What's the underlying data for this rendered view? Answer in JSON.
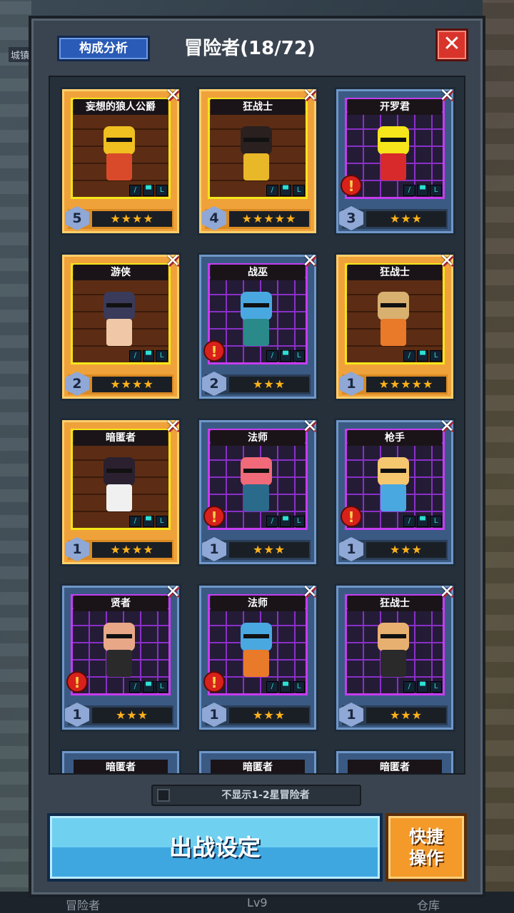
{
  "header": {
    "analysis_label": "构成分析",
    "title": "冒险者(18/72)",
    "close_icon": "close-icon"
  },
  "background": {
    "top_left_text": "城镇",
    "bottom_left_text": "冒险者",
    "bottom_center_text": "Lv9",
    "bottom_right_text": "仓库"
  },
  "cards": [
    {
      "name": "妄想的狼人公爵",
      "level": "5",
      "stars": "★★★★",
      "tier": "gold",
      "alert": false,
      "head": "#f0c020",
      "body": "#d84a2a"
    },
    {
      "name": "狂战士",
      "level": "4",
      "stars": "★★★★★",
      "tier": "gold",
      "alert": false,
      "head": "#2a2020",
      "body": "#e8b828"
    },
    {
      "name": "开罗君",
      "level": "3",
      "stars": "★★★",
      "tier": "blue",
      "alert": true,
      "head": "#f5e51a",
      "body": "#d82a2a"
    },
    {
      "name": "游侠",
      "level": "2",
      "stars": "★★★★",
      "tier": "gold",
      "alert": false,
      "head": "#3a3a5a",
      "body": "#f0c8a8"
    },
    {
      "name": "战巫",
      "level": "2",
      "stars": "★★★",
      "tier": "blue",
      "alert": true,
      "head": "#4aa8e0",
      "body": "#2a8a8a"
    },
    {
      "name": "狂战士",
      "level": "1",
      "stars": "★★★★★",
      "tier": "gold",
      "alert": false,
      "head": "#d8b070",
      "body": "#e87a2a"
    },
    {
      "name": "暗匿者",
      "level": "1",
      "stars": "★★★★",
      "tier": "gold",
      "alert": false,
      "head": "#2a2030",
      "body": "#f0f0f0"
    },
    {
      "name": "法师",
      "level": "1",
      "stars": "★★★",
      "tier": "blue",
      "alert": true,
      "head": "#f06a7a",
      "body": "#2a6a8a"
    },
    {
      "name": "枪手",
      "level": "1",
      "stars": "★★★",
      "tier": "blue",
      "alert": true,
      "head": "#f5c870",
      "body": "#4aa8e0"
    },
    {
      "name": "贤者",
      "level": "1",
      "stars": "★★★",
      "tier": "blue",
      "alert": true,
      "head": "#e8a888",
      "body": "#2a2a2a"
    },
    {
      "name": "法师",
      "level": "1",
      "stars": "★★★",
      "tier": "blue",
      "alert": true,
      "head": "#4aa8e0",
      "body": "#e87a2a"
    },
    {
      "name": "狂战士",
      "level": "1",
      "stars": "★★★",
      "tier": "blue",
      "alert": false,
      "head": "#e8b070",
      "body": "#2a2a2a"
    }
  ],
  "partial_cards": [
    {
      "name": "暗匿者"
    },
    {
      "name": "暗匿者"
    },
    {
      "name": "暗匿者"
    }
  ],
  "toggle": {
    "label": "不显示1-2星冒险者",
    "checked": false
  },
  "buttons": {
    "battle_label": "出战设定",
    "quick_line1": "快捷",
    "quick_line2": "操作"
  }
}
